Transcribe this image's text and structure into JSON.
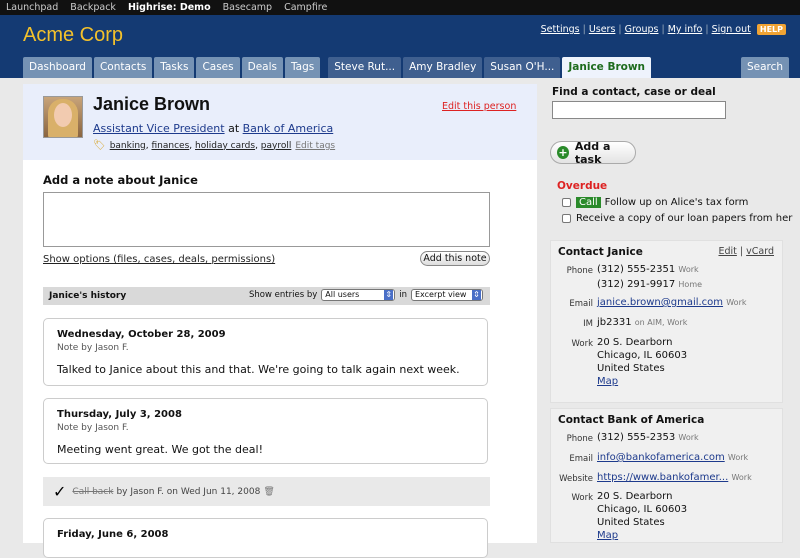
{
  "topnav": [
    "Launchpad",
    "Backpack",
    "Highrise: Demo",
    "Basecamp",
    "Campfire"
  ],
  "topnav_active": "Highrise: Demo",
  "brand": "Acme Corp",
  "toplinks": [
    "Settings",
    "Users",
    "Groups",
    "My info",
    "Sign out"
  ],
  "help": "HELP",
  "tabs": {
    "main": [
      "Dashboard",
      "Contacts",
      "Tasks",
      "Cases",
      "Deals",
      "Tags"
    ],
    "people": [
      "Steve Rut...",
      "Amy Bradley",
      "Susan O'H..."
    ],
    "active": "Janice Brown",
    "search": "Search"
  },
  "person": {
    "name": "Janice Brown",
    "edit_link": "Edit this person",
    "title": "Assistant Vice President",
    "at": "at",
    "company": "Bank of America",
    "tags": [
      "banking",
      "finances",
      "holiday cards",
      "payroll"
    ],
    "edit_tags": "Edit tags"
  },
  "note_form": {
    "heading": "Add a note about Janice",
    "show_options": "Show options (files, cases, deals, permissions)",
    "add_button": "Add this note"
  },
  "history": {
    "title": "Janice's history",
    "show_entries_by": "Show entries by",
    "users_select": "All users",
    "in": "in",
    "view_select": "Excerpt view",
    "notes": [
      {
        "date": "Wednesday, October 28, 2009",
        "by": "Note by Jason F.",
        "body": "Talked to Janice about this and that. We're going to talk again next week."
      },
      {
        "date": "Thursday, July 3, 2008",
        "by": "Note by Jason F.",
        "body": "Meeting went great. We got the deal!"
      },
      {
        "date": "Friday, June 6, 2008",
        "by": "",
        "body": ""
      }
    ],
    "completed_task": {
      "label": "Call back",
      "by": "by Jason F. on Wed Jun 11, 2008"
    }
  },
  "sidebar": {
    "find_heading": "Find a contact, case or deal",
    "add_task": "Add a task",
    "overdue": "Overdue",
    "tasks": [
      {
        "badge": "Call",
        "text": "Follow up on Alice's tax form"
      },
      {
        "badge": "",
        "text": "Receive a copy of our loan papers from her"
      }
    ],
    "contact_person": {
      "heading": "Contact Janice",
      "edit": "Edit",
      "vcard": "vCard",
      "phone_label": "Phone",
      "phones": [
        {
          "num": "(312) 555-2351",
          "type": "Work"
        },
        {
          "num": "(312) 291-9917",
          "type": "Home"
        }
      ],
      "email_label": "Email",
      "email": "janice.brown@gmail.com",
      "email_type": "Work",
      "im_label": "IM",
      "im": "jb2331",
      "im_type": "on AIM, Work",
      "work_label": "Work",
      "address": [
        "20 S. Dearborn",
        "Chicago, IL 60603",
        "United States"
      ],
      "map": "Map"
    },
    "contact_company": {
      "heading": "Contact Bank of America",
      "phone_label": "Phone",
      "phone": "(312) 555-2353",
      "phone_type": "Work",
      "email_label": "Email",
      "email": "info@bankofamerica.com",
      "email_type": "Work",
      "website_label": "Website",
      "website": "https://www.bankofamer...",
      "website_type": "Work",
      "work_label": "Work",
      "address": [
        "20 S. Dearborn",
        "Chicago, IL 60603",
        "United States"
      ],
      "map": "Map"
    }
  }
}
